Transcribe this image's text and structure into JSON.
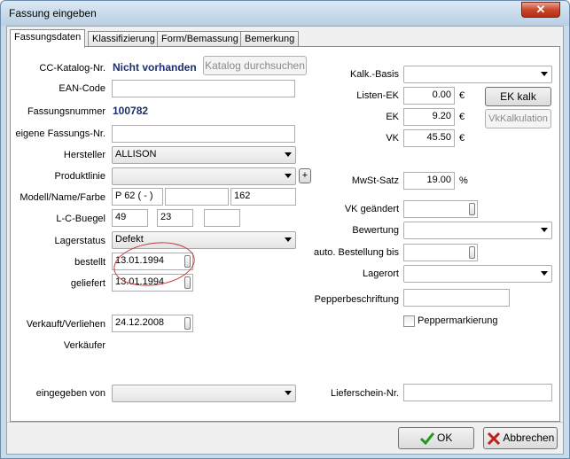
{
  "window": {
    "title": "Fassung eingeben",
    "close": "✕"
  },
  "tabs": [
    {
      "label": "Fassungsdaten",
      "active": true
    },
    {
      "label": "Klassifizierung"
    },
    {
      "label": "Form/Bemassung"
    },
    {
      "label": "Bemerkung"
    }
  ],
  "left": {
    "cc_katalog_label": "CC-Katalog-Nr.",
    "cc_katalog_value": "Nicht vorhanden",
    "katalog_button": "Katalog durchsuchen",
    "ean_label": "EAN-Code",
    "ean_value": "",
    "fassungsnummer_label": "Fassungsnummer",
    "fassungsnummer_value": "100782",
    "eigene_nr_label": "eigene Fassungs-Nr.",
    "eigene_nr_value": "",
    "hersteller_label": "Hersteller",
    "hersteller_value": "ALLISON",
    "produktlinie_label": "Produktlinie",
    "produktlinie_value": "",
    "plus_button": "+",
    "modell_label": "Modell/Name/Farbe",
    "modell_value": "P 62 ( - )",
    "name_value": "",
    "farbe_value": "162",
    "lcb_label": "L-C-Buegel",
    "l_value": "49",
    "c_value": "23",
    "buegel_value": "",
    "lagerstatus_label": "Lagerstatus",
    "lagerstatus_value": "Defekt",
    "bestellt_label": "bestellt",
    "bestellt_value": "13.01.1994",
    "geliefert_label": "geliefert",
    "geliefert_value": "13.01.1994",
    "verkauft_label": "Verkauft/Verliehen",
    "verkauft_value": "24.12.2008",
    "verkaeufer_label": "Verkäufer",
    "eingegeben_label": "eingegeben von",
    "eingegeben_value": ""
  },
  "right": {
    "kalk_basis_label": "Kalk.-Basis",
    "kalk_basis_value": "",
    "listen_ek_label": "Listen-EK",
    "listen_ek_value": "0.00",
    "ek_label": "EK",
    "ek_value": "9.20",
    "vk_label": "VK",
    "vk_value": "45.50",
    "currency": "€",
    "ek_kalk_button": "EK kalk",
    "vk_kalk_button": "VkKalkulation",
    "mwst_label": "MwSt-Satz",
    "mwst_value": "19.00",
    "percent": "%",
    "vk_geaendert_label": "VK geändert",
    "vk_geaendert_value": "",
    "bewertung_label": "Bewertung",
    "bewertung_value": "",
    "auto_bestellung_label": "auto. Bestellung bis",
    "auto_bestellung_value": "",
    "lagerort_label": "Lagerort",
    "lagerort_value": "",
    "pepperbeschriftung_label": "Pepperbeschriftung",
    "pepperbeschriftung_value": "",
    "peppermarkierung_label": "Peppermarkierung",
    "lieferschein_label": "Lieferschein-Nr.",
    "lieferschein_value": ""
  },
  "footer": {
    "ok_label": "OK",
    "abbrechen_label": "Abbrechen"
  },
  "colors": {
    "ok_check": "#1f9b1f",
    "cancel_x": "#c0201c",
    "annotation": "#c23b3b"
  }
}
